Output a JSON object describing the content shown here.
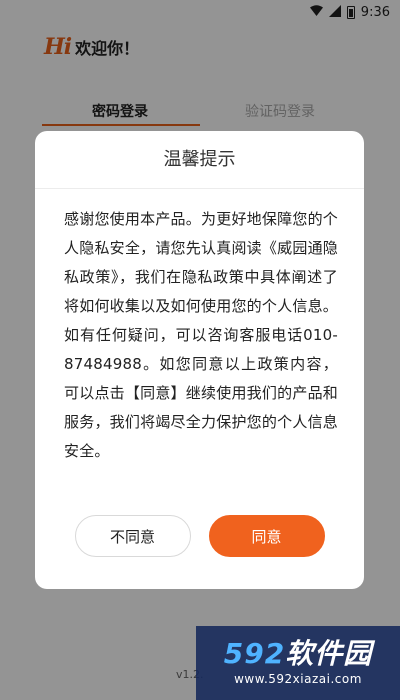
{
  "status_bar": {
    "time": "9:36",
    "icons": [
      "wifi-icon",
      "signal-icon",
      "battery-icon"
    ]
  },
  "brand": {
    "hi": "Hi",
    "welcome": "欢迎你！",
    "accent_color": "#e8611a"
  },
  "login_tabs": [
    {
      "label": "密码登录",
      "active": true
    },
    {
      "label": "验证码登录",
      "active": false
    }
  ],
  "version": "v1.2.",
  "dialog": {
    "title": "温馨提示",
    "body": "感谢您使用本产品。为更好地保障您的个人隐私安全，请您先认真阅读《威园通隐私政策》，我们在隐私政策中具体阐述了将如何收集以及如何使用您的个人信息。如有任何疑问，可以咨询客服电话010-87484988。如您同意以上政策内容，可以点击【同意】继续使用我们的产品和服务，我们将竭尽全力保护您的个人信息安全。",
    "disagree_label": "不同意",
    "agree_label": "同意",
    "agree_color": "#f0621e"
  },
  "watermark": {
    "number": "592",
    "text": "软件园",
    "url": "www.592xiazai.com"
  }
}
